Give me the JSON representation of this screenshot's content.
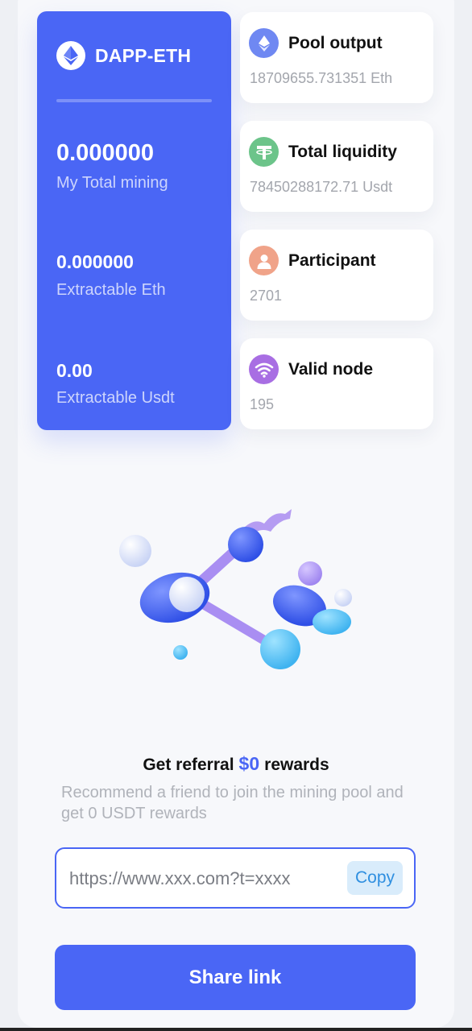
{
  "pool": {
    "name": "DAPP-ETH",
    "icon": "ethereum-icon",
    "total_mining": {
      "value": "0.000000",
      "label": "My Total mining"
    },
    "extractable_eth": {
      "value": "0.000000",
      "label": "Extractable Eth"
    },
    "extractable_usdt": {
      "value": "0.00",
      "label": "Extractable Usdt"
    }
  },
  "stats": [
    {
      "title": "Pool output",
      "value": "18709655.731351 Eth",
      "icon": "ethereum-icon",
      "color": "#6f88f2"
    },
    {
      "title": "Total liquidity",
      "value": "78450288172.71 Usdt",
      "icon": "tether-icon",
      "color": "#6cc48a"
    },
    {
      "title": "Participant",
      "value": "2701",
      "icon": "user-icon",
      "color": "#f0a389"
    },
    {
      "title": "Valid node",
      "value": "195",
      "icon": "wifi-icon",
      "color": "#a86ee3"
    }
  ],
  "referral": {
    "title_prefix": "Get referral",
    "amount": "$0",
    "title_suffix": "rewards",
    "description": "Recommend a friend to join the mining pool and get 0 USDT rewards",
    "link": "https://www.xxx.com?t=xxxx",
    "copy_label": "Copy",
    "share_label": "Share link"
  },
  "colors": {
    "accent": "#4a66f5",
    "copy_bg": "#d9ecfb",
    "copy_text": "#2f8fe0"
  }
}
